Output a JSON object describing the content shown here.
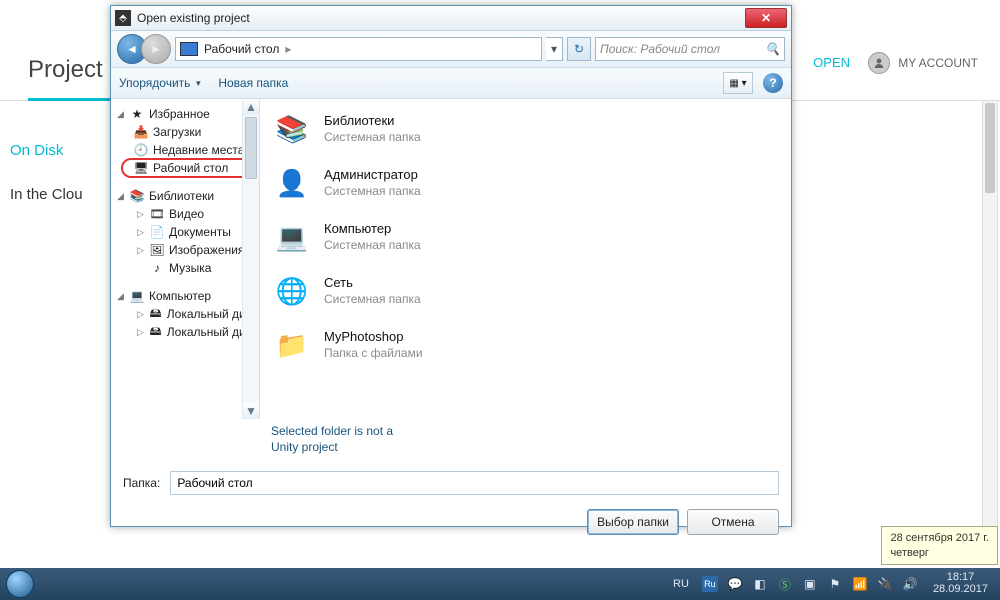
{
  "background": {
    "projects_title": "Project",
    "on_disk": "On Disk",
    "in_cloud": "In the Clou",
    "open": "OPEN",
    "my_account": "MY ACCOUNT"
  },
  "dialog": {
    "title": "Open existing project",
    "address": "Рабочий стол",
    "address_sep": "▸",
    "search_placeholder": "Поиск: Рабочий стол",
    "toolbar": {
      "organize": "Упорядочить",
      "new_folder": "Новая папка"
    },
    "tree": {
      "fav": "Избранное",
      "fav_items": [
        "Загрузки",
        "Недавние места",
        "Рабочий стол"
      ],
      "lib": "Библиотеки",
      "lib_items": [
        "Видео",
        "Документы",
        "Изображения",
        "Музыка"
      ],
      "comp": "Компьютер",
      "comp_items": [
        "Локальный диск",
        "Локальный диск"
      ]
    },
    "items": [
      {
        "name": "Библиотеки",
        "sub": "Системная папка"
      },
      {
        "name": "Администратор",
        "sub": "Системная папка"
      },
      {
        "name": "Компьютер",
        "sub": "Системная папка"
      },
      {
        "name": "Сеть",
        "sub": "Системная папка"
      },
      {
        "name": "MyPhotoshop",
        "sub": "Папка с файлами"
      }
    ],
    "status_l1": "Selected folder is not a",
    "status_l2": "Unity project",
    "folder_label": "Папка:",
    "folder_value": "Рабочий стол",
    "btn_select": "Выбор папки",
    "btn_cancel": "Отмена"
  },
  "tooltip": {
    "l1": "28 сентября 2017 г.",
    "l2": "четверг"
  },
  "taskbar": {
    "lang": "RU",
    "ru": "Ru",
    "time": "18:17",
    "date": "28.09.2017"
  }
}
